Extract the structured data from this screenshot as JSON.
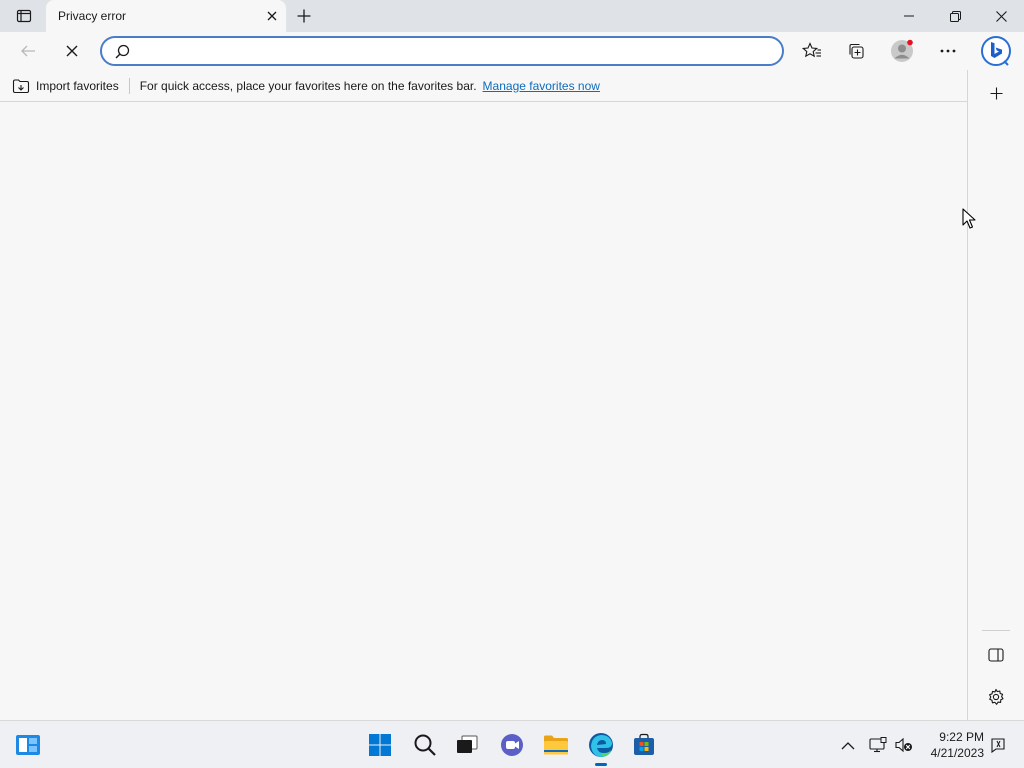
{
  "tab": {
    "title": "Privacy error"
  },
  "addressbar": {
    "value": "",
    "placeholder": ""
  },
  "favorites_bar": {
    "import_label": "Import favorites",
    "message": "For quick access, place your favorites here on the favorites bar.",
    "link": "Manage favorites now"
  },
  "taskbar": {
    "time": "9:22 PM",
    "date": "4/21/2023"
  },
  "colors": {
    "accent": "#0067c0",
    "link": "#0f6cbd",
    "address_border": "#4a7cc8",
    "profile_dot": "#e81123"
  }
}
